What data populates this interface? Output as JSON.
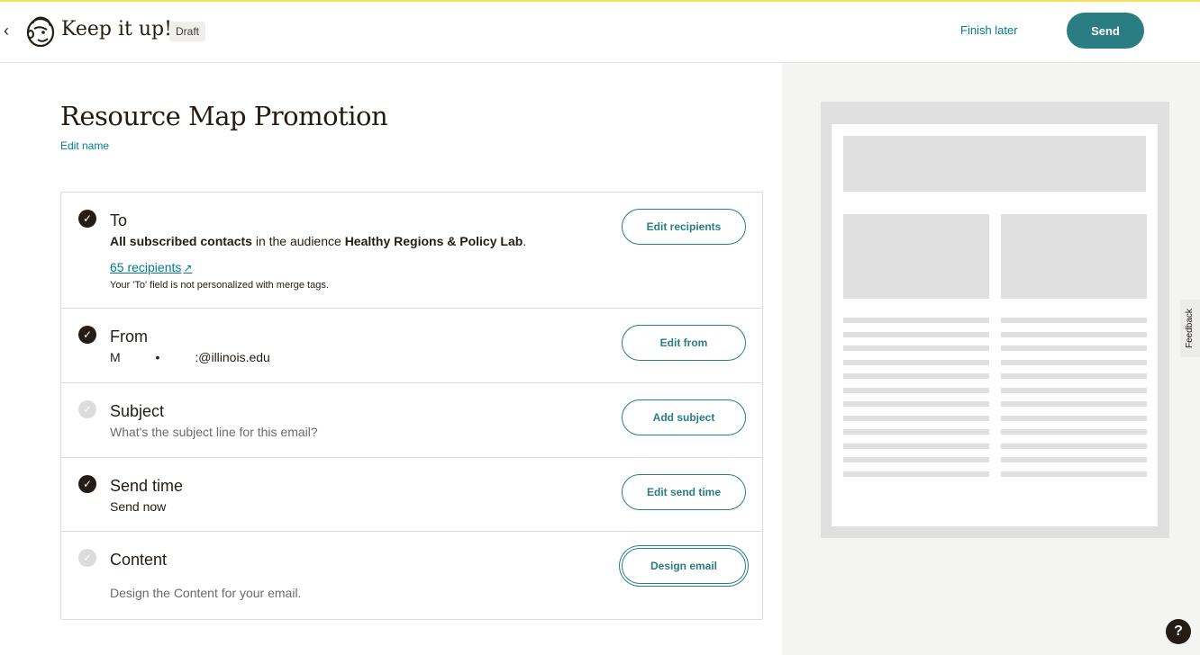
{
  "header": {
    "brand": "Keep it up!",
    "badge": "Draft",
    "finish_later": "Finish later",
    "send": "Send"
  },
  "campaign": {
    "name": "Resource Map Promotion",
    "edit_name": "Edit name"
  },
  "checklist": {
    "to": {
      "title": "To",
      "desc_bold_1": "All subscribed contacts",
      "desc_mid": " in the audience ",
      "desc_bold_2": "Healthy Regions & Policy Lab",
      "desc_end": ".",
      "recipients_link": "65 recipients",
      "note": "Your 'To' field is not personalized with merge tags.",
      "button": "Edit recipients",
      "status": "complete"
    },
    "from": {
      "title": "From",
      "desc": "M          •          :@illinois.edu",
      "button": "Edit from",
      "status": "complete"
    },
    "subject": {
      "title": "Subject",
      "desc": "What's the subject line for this email?",
      "button": "Add subject",
      "status": "incomplete"
    },
    "send_time": {
      "title": "Send time",
      "desc": "Send now",
      "button": "Edit send time",
      "status": "complete"
    },
    "content": {
      "title": "Content",
      "desc": "Design the Content for your email.",
      "button": "Design email",
      "status": "incomplete"
    }
  },
  "side": {
    "feedback": "Feedback",
    "help": "?"
  },
  "icons": {
    "back": "chevron-left-icon",
    "logo": "mailchimp-freddie-icon",
    "check": "checkmark-icon",
    "external": "external-link-icon"
  },
  "colors": {
    "accent": "#2a7d83",
    "link": "#007c89",
    "top_line": "#f6e05e",
    "dark": "#241c15"
  }
}
